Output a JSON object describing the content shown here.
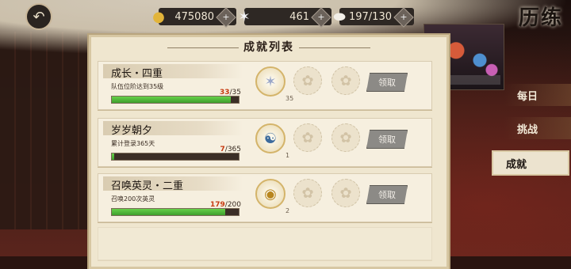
{
  "top_bar": {
    "currencies": [
      {
        "icon": "gold-coin-icon",
        "value": "475080"
      },
      {
        "icon": "star-crystal-icon",
        "value": "461"
      },
      {
        "icon": "stamina-stone-icon",
        "value": "197/130"
      }
    ],
    "plus_label": "+",
    "page_title": "历练"
  },
  "panel": {
    "title": "成就列表",
    "claim_label": "领取",
    "achievements": [
      {
        "name": "成长・四重",
        "desc": "队伍位阶达到35级",
        "current": "33",
        "total": "/35",
        "progress": 0.94,
        "reward_icon": "crystal-star-icon",
        "reward_count": "35"
      },
      {
        "name": "岁岁朝夕",
        "desc": "累计登录365天",
        "current": "7",
        "total": "/365",
        "progress": 0.02,
        "reward_icon": "banner-charm-icon",
        "reward_count": "1"
      },
      {
        "name": "召唤英灵・二重",
        "desc": "召唤200次英灵",
        "current": "179",
        "total": "/200",
        "progress": 0.895,
        "reward_icon": "summon-token-icon",
        "reward_count": "2"
      }
    ]
  },
  "tabs": [
    {
      "label": "每日",
      "active": false
    },
    {
      "label": "挑战",
      "active": false
    },
    {
      "label": "成就",
      "active": true
    }
  ]
}
